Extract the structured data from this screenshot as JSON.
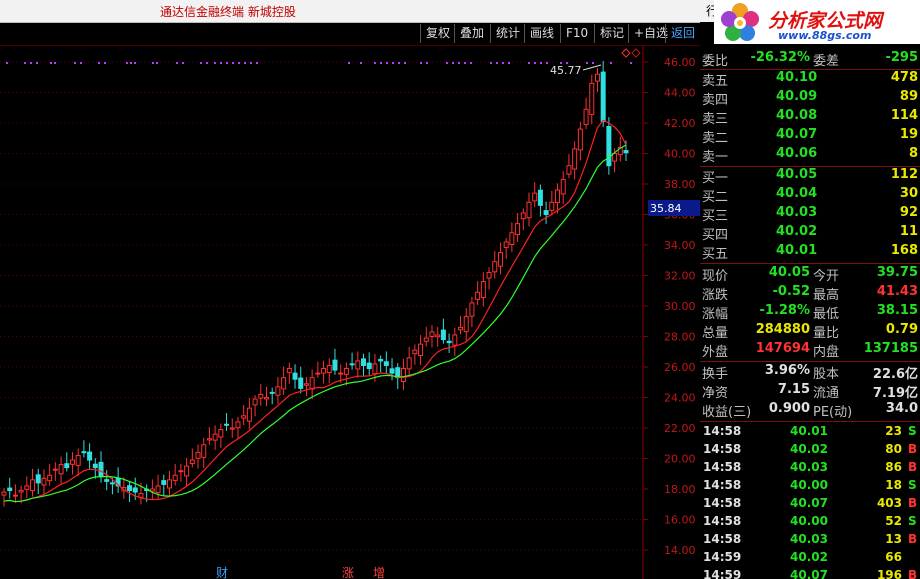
{
  "window": {
    "title": "通达信金融终端  新城控股",
    "left_label": "行"
  },
  "logo": {
    "brand": "分析家公式网",
    "url": "www.88gs.com"
  },
  "toolbar": [
    {
      "label": "复权",
      "active": false
    },
    {
      "label": "叠加",
      "active": false
    },
    {
      "label": "统计",
      "active": false
    },
    {
      "label": "画线",
      "active": false
    },
    {
      "label": "F10",
      "active": false
    },
    {
      "label": "标记",
      "active": false
    },
    {
      "label": "+自选",
      "active": false
    },
    {
      "label": "返回",
      "active": true
    }
  ],
  "chart": {
    "y_ticks": [
      "46.00",
      "44.00",
      "42.00",
      "40.00",
      "38.00",
      "36.00",
      "34.00",
      "32.00",
      "30.00",
      "28.00",
      "26.00",
      "24.00",
      "22.00",
      "20.00",
      "18.00",
      "16.00",
      "14.00"
    ],
    "peak_label": "45.77",
    "cursor_price": "35.84",
    "bottom_markers": [
      {
        "text": "财",
        "color": "#3aa0ff"
      },
      {
        "text": "涨",
        "color": "#ff4040"
      },
      {
        "text": "增",
        "color": "#ff4040"
      }
    ],
    "colors": {
      "up": "#ff3030",
      "down": "#30e0e0",
      "ma_fast": "#ff2020",
      "ma_slow": "#30ff30",
      "dots": "#b040ff"
    }
  },
  "quote": {
    "header": {
      "label1": "委比",
      "value1": "-26.32%",
      "label2": "委差",
      "value2": "-295"
    },
    "asks": [
      {
        "label": "卖五",
        "price": "40.10",
        "vol": "478"
      },
      {
        "label": "卖四",
        "price": "40.09",
        "vol": "89"
      },
      {
        "label": "卖三",
        "price": "40.08",
        "vol": "114"
      },
      {
        "label": "卖二",
        "price": "40.07",
        "vol": "19"
      },
      {
        "label": "卖一",
        "price": "40.06",
        "vol": "8"
      }
    ],
    "bids": [
      {
        "label": "买一",
        "price": "40.05",
        "vol": "112"
      },
      {
        "label": "买二",
        "price": "40.04",
        "vol": "30"
      },
      {
        "label": "买三",
        "price": "40.03",
        "vol": "92"
      },
      {
        "label": "买四",
        "price": "40.02",
        "vol": "11"
      },
      {
        "label": "买五",
        "price": "40.01",
        "vol": "168"
      }
    ],
    "stats": [
      {
        "l1": "现价",
        "v1": "40.05",
        "c1": "green",
        "l2": "今开",
        "v2": "39.75",
        "c2": "green"
      },
      {
        "l1": "涨跌",
        "v1": "-0.52",
        "c1": "green",
        "l2": "最高",
        "v2": "41.43",
        "c2": "red"
      },
      {
        "l1": "涨幅",
        "v1": "-1.28%",
        "c1": "green",
        "l2": "最低",
        "v2": "38.15",
        "c2": "green"
      },
      {
        "l1": "总量",
        "v1": "284880",
        "c1": "yellow",
        "l2": "量比",
        "v2": "0.79",
        "c2": "yellow"
      },
      {
        "l1": "外盘",
        "v1": "147694",
        "c1": "red",
        "l2": "内盘",
        "v2": "137185",
        "c2": "green"
      }
    ],
    "fundamentals": [
      {
        "l1": "换手",
        "v1": "3.96%",
        "l2": "股本",
        "v2": "22.6亿"
      },
      {
        "l1": "净资",
        "v1": "7.15",
        "l2": "流通",
        "v2": "7.19亿"
      },
      {
        "l1": "收益(三)",
        "v1": "0.900",
        "l2": "PE(动)",
        "v2": "34.0"
      }
    ],
    "ticks": [
      {
        "time": "14:58",
        "price": "40.01",
        "vol": "23",
        "side": "S"
      },
      {
        "time": "14:58",
        "price": "40.02",
        "vol": "80",
        "side": "B"
      },
      {
        "time": "14:58",
        "price": "40.03",
        "vol": "86",
        "side": "B"
      },
      {
        "time": "14:58",
        "price": "40.00",
        "vol": "18",
        "side": "S"
      },
      {
        "time": "14:58",
        "price": "40.07",
        "vol": "403",
        "side": "B"
      },
      {
        "time": "14:58",
        "price": "40.00",
        "vol": "52",
        "side": "S"
      },
      {
        "time": "14:58",
        "price": "40.03",
        "vol": "13",
        "side": "B"
      },
      {
        "time": "14:59",
        "price": "40.02",
        "vol": "66",
        "side": ""
      },
      {
        "time": "14:59",
        "price": "40.07",
        "vol": "196",
        "side": "B"
      }
    ]
  }
}
